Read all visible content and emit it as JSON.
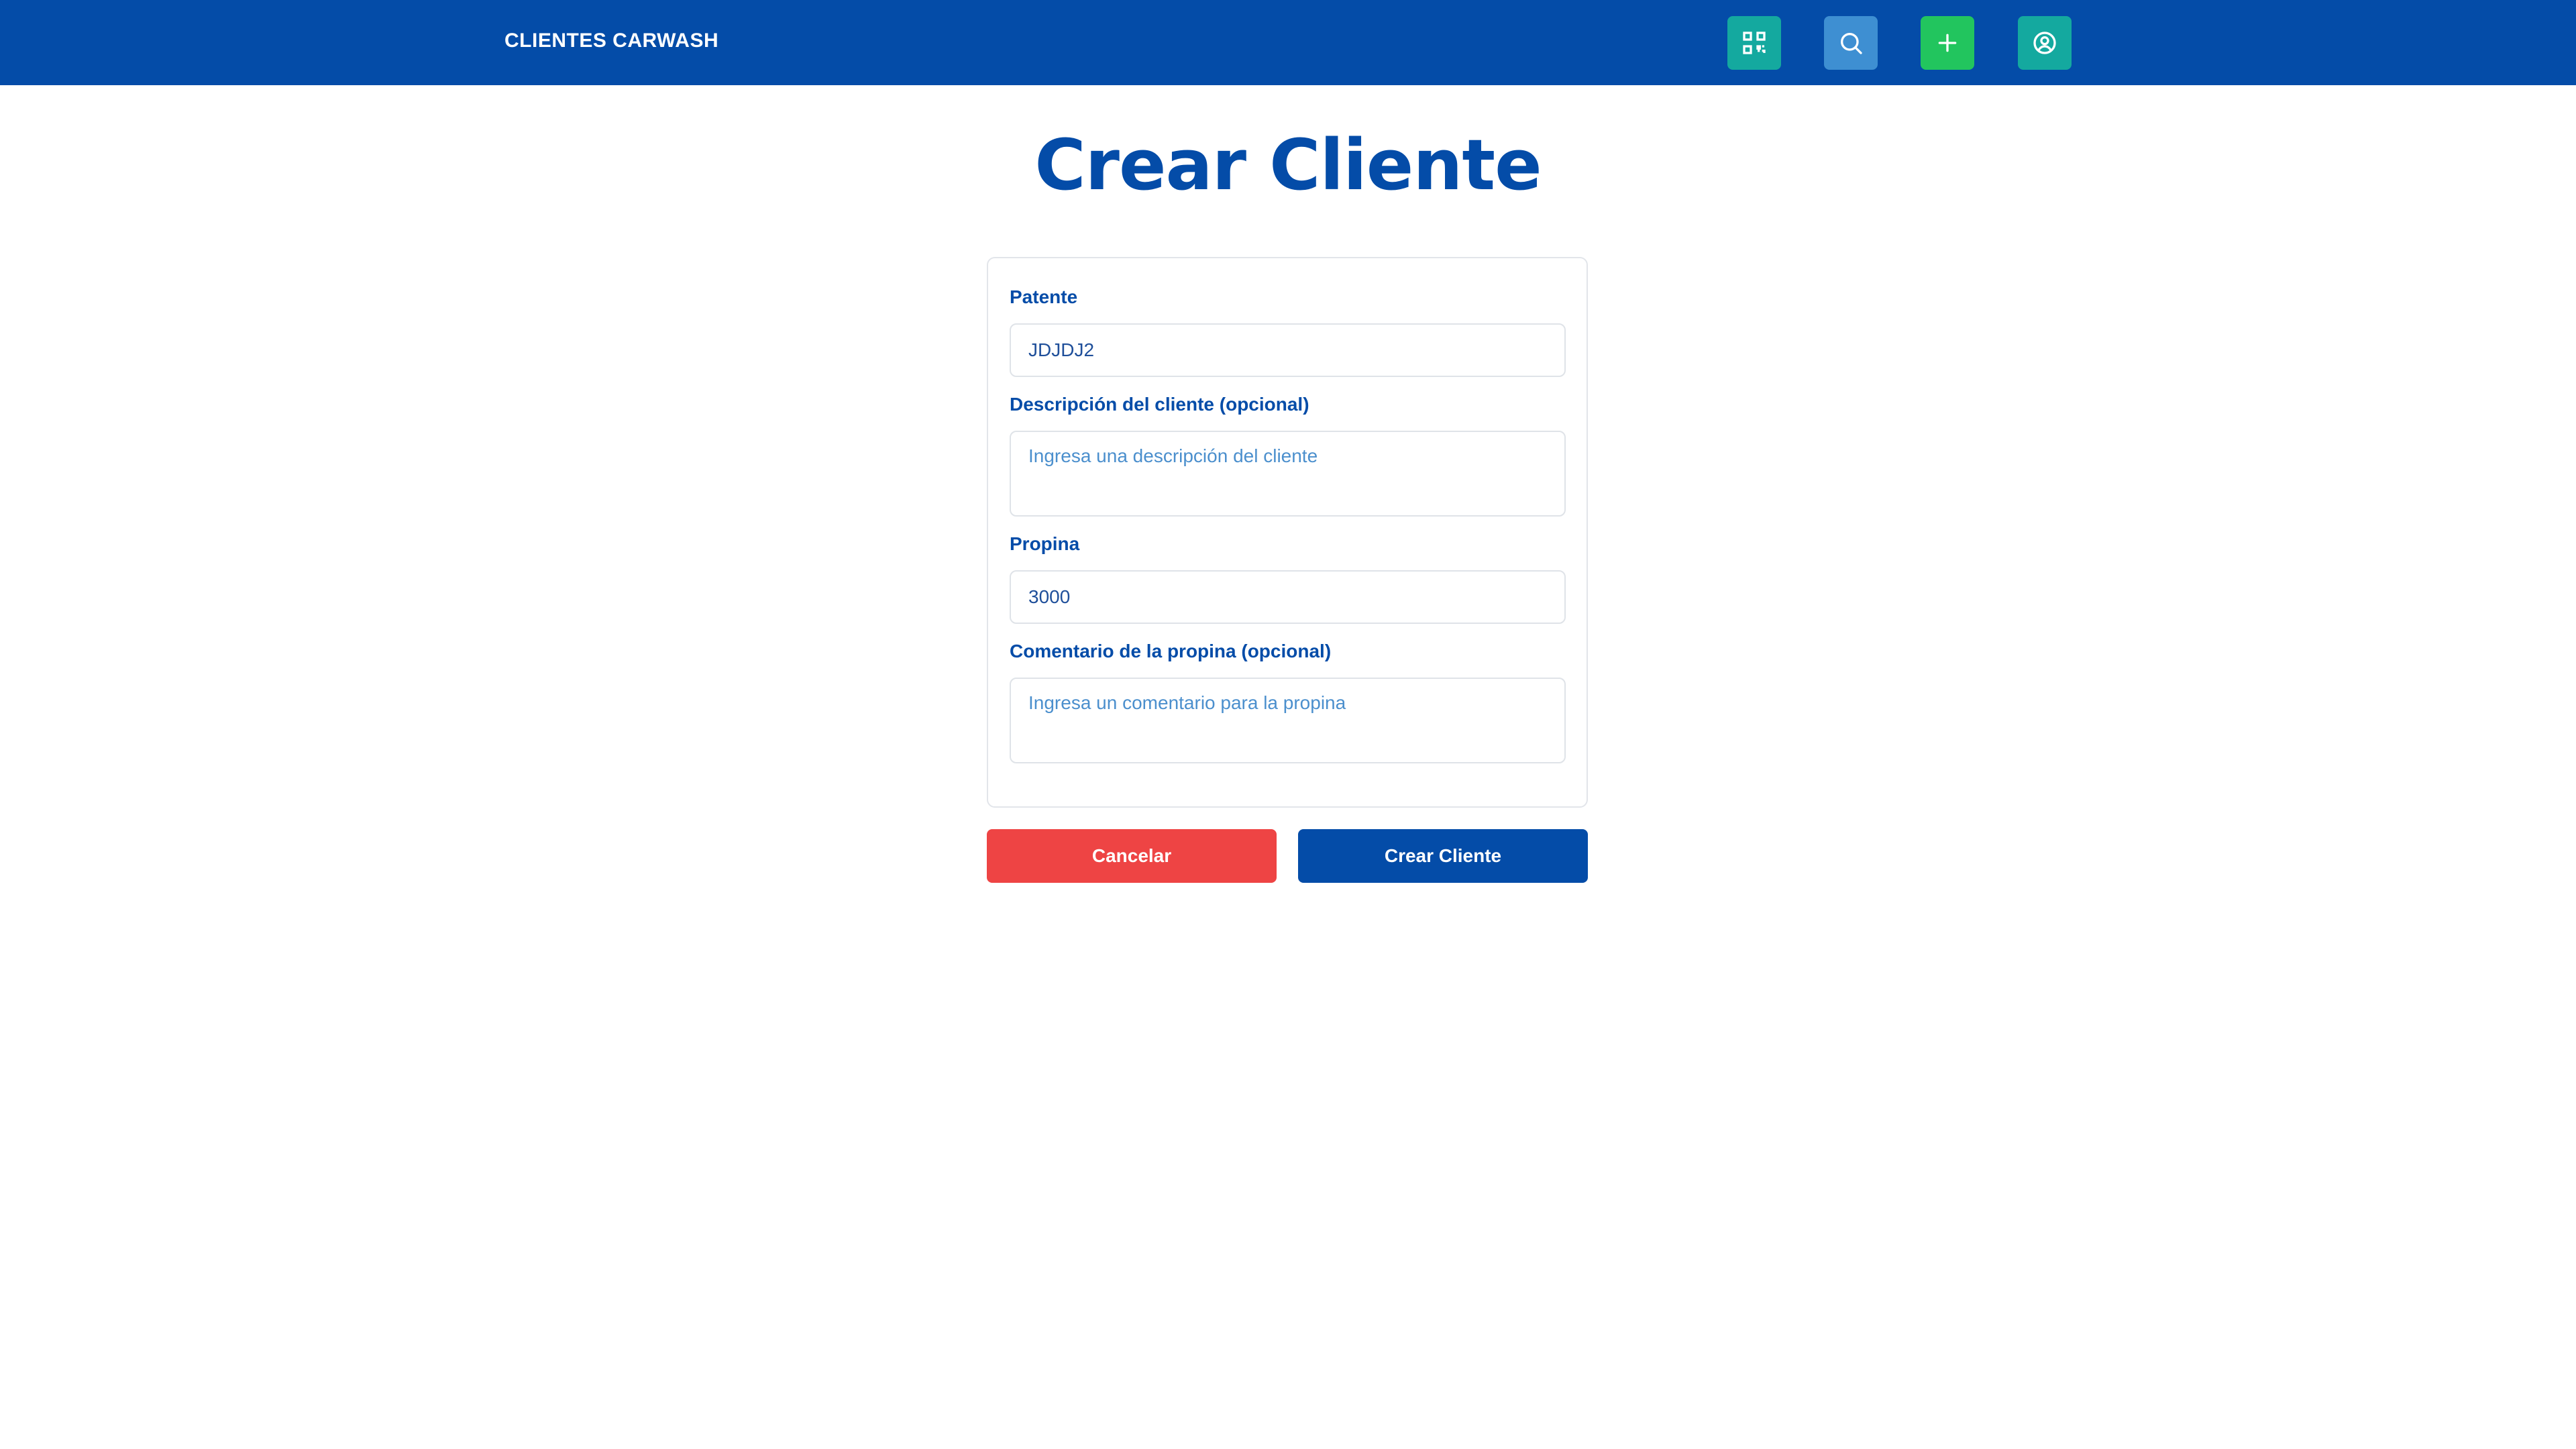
{
  "header": {
    "brand": "CLIENTES CARWASH",
    "icons": [
      "qr-code-icon",
      "search-icon",
      "plus-icon",
      "user-circle-icon"
    ],
    "colors": {
      "navbar": "#044ca8",
      "qr_button": "#14a99f",
      "search_button": "#3e8fd2",
      "add_button": "#22c55e",
      "user_button": "#14a99f"
    }
  },
  "page": {
    "title": "Crear Cliente"
  },
  "form": {
    "patente_label": "Patente",
    "patente_value": "JDJDJ2",
    "descripcion_label": "Descripción del cliente (opcional)",
    "descripcion_placeholder": "Ingresa una descripción del cliente",
    "propina_label": "Propina",
    "propina_value": "3000",
    "comentario_label": "Comentario de la propina (opcional)",
    "comentario_placeholder": "Ingresa un comentario para la propina"
  },
  "actions": {
    "cancel_label": "Cancelar",
    "create_label": "Crear Cliente",
    "colors": {
      "cancel": "#ee4444",
      "create": "#044ca8"
    }
  }
}
